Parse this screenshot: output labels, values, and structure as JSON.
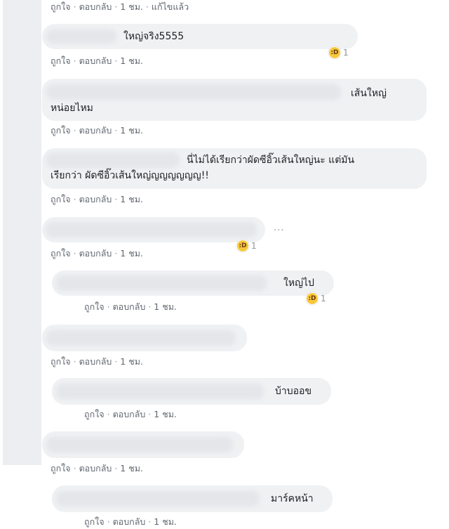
{
  "meta": {
    "like": "ถูกใจ",
    "reply": "ตอบกลับ",
    "time": "1 ชม.",
    "edited": "แก้ไขแล้ว",
    "sep": "·"
  },
  "comments": [
    {
      "text": ""
    },
    {
      "text": "ใหญ่จริง5555",
      "reaction_count": "1"
    },
    {
      "text_line1": "เส้นใหญ่",
      "text_line2": "หน่อยไหม"
    },
    {
      "text_line1": "นี่ไม่ได้เรียกว่าผัดซีอิ๊วเส้นใหญ่นะ แต่มัน",
      "text_line2": "เรียกว่า ผัดซีอิ๊วเส้นใหญ่ญญญญญญ!!"
    },
    {
      "text": "",
      "reaction_count": "1",
      "more": "···"
    },
    {
      "text": "ใหญ่ไป",
      "reaction_count": "1"
    },
    {
      "text": ""
    },
    {
      "text": "บ้าบออข"
    },
    {
      "text": ""
    },
    {
      "text": "มาร์คหน้า"
    }
  ],
  "colors": {
    "bubble": "#eff1f3",
    "meta": "#616770",
    "reaction": "#f7c83b"
  }
}
